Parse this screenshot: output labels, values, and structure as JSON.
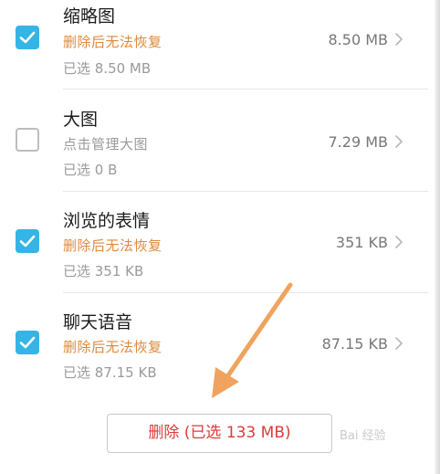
{
  "items": [
    {
      "title": "缩略图",
      "subtitle": "删除后无法恢复",
      "selected": "已选 8.50 MB",
      "size": "8.50 MB",
      "checked": true
    },
    {
      "title": "大图",
      "subtitle": "点击管理大图",
      "selected": "已选 0 B",
      "size": "7.29 MB",
      "checked": false
    },
    {
      "title": "浏览的表情",
      "subtitle": "删除后无法恢复",
      "selected": "已选 351 KB",
      "size": "351 KB",
      "checked": true
    },
    {
      "title": "聊天语音",
      "subtitle": "删除后无法恢复",
      "selected": "已选 87.15 KB",
      "size": "87.15 KB",
      "checked": true
    }
  ],
  "delete_button": {
    "label": "删除 (已选 133 MB)"
  },
  "watermark": {
    "text": "Bai 经验"
  },
  "colors": {
    "checkbox_checked": "#35b4e6",
    "warning_text": "#de8a3c",
    "delete_text": "#dd3b3b",
    "annotation_arrow": "#f0a35e"
  }
}
